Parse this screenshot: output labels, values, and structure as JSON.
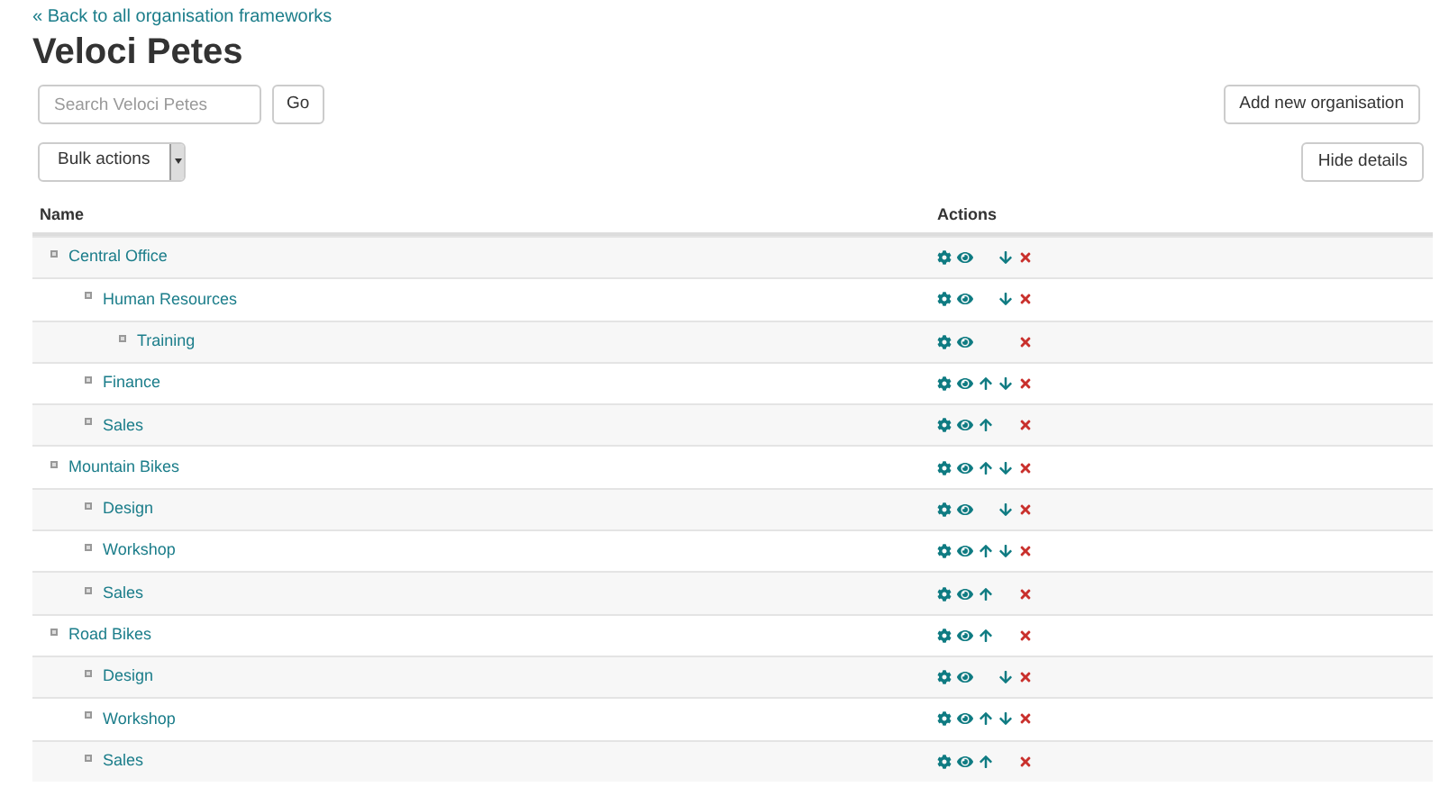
{
  "back_link": "« Back to all organisation frameworks",
  "title": "Veloci Petes",
  "search": {
    "placeholder": "Search Veloci Petes",
    "button": "Go"
  },
  "add_button": "Add new organisation",
  "bulk_actions": "Bulk actions",
  "hide_details_button": "Hide details",
  "table": {
    "columns": [
      "Name",
      "Actions"
    ],
    "rows": [
      {
        "name": "Central Office",
        "move_up": false,
        "move_down": true,
        "children": [
          {
            "name": "Human Resources",
            "move_up": false,
            "move_down": true,
            "children": [
              {
                "name": "Training",
                "move_up": false,
                "move_down": false
              }
            ]
          },
          {
            "name": "Finance",
            "move_up": true,
            "move_down": true
          },
          {
            "name": "Sales",
            "move_up": true,
            "move_down": false
          }
        ]
      },
      {
        "name": "Mountain Bikes",
        "move_up": true,
        "move_down": true,
        "children": [
          {
            "name": "Design",
            "move_up": false,
            "move_down": true
          },
          {
            "name": "Workshop",
            "move_up": true,
            "move_down": true
          },
          {
            "name": "Sales",
            "move_up": true,
            "move_down": false
          }
        ]
      },
      {
        "name": "Road Bikes",
        "move_up": true,
        "move_down": false,
        "children": [
          {
            "name": "Design",
            "move_up": false,
            "move_down": true
          },
          {
            "name": "Workshop",
            "move_up": true,
            "move_down": true
          },
          {
            "name": "Sales",
            "move_up": true,
            "move_down": false
          }
        ]
      }
    ]
  }
}
